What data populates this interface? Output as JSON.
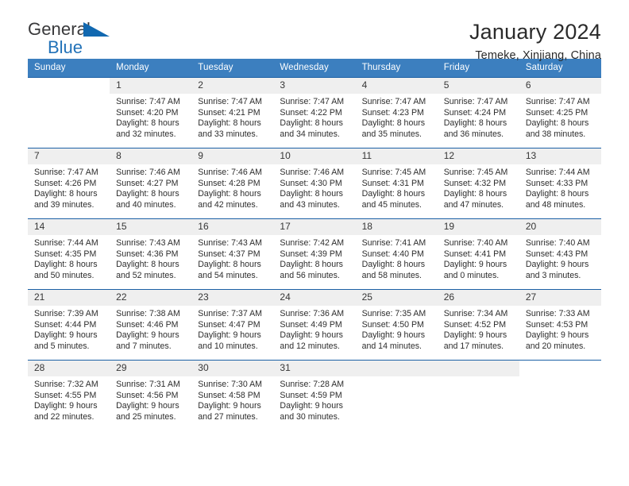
{
  "brand": {
    "name_top": "General",
    "name_bottom": "Blue",
    "accent_color": "#1168b0",
    "text_color": "#39393b"
  },
  "header": {
    "title": "January 2024",
    "subtitle": "Temeke, Xinjiang, China"
  },
  "theme": {
    "header_band": "#3c7fbf",
    "row_rule": "#1b60a5",
    "daynum_band": "#efefef"
  },
  "weekday_headers": [
    "Sunday",
    "Monday",
    "Tuesday",
    "Wednesday",
    "Thursday",
    "Friday",
    "Saturday"
  ],
  "labels": {
    "sunrise_prefix": "Sunrise:",
    "sunset_prefix": "Sunset:",
    "daylight_prefix": "Daylight:"
  },
  "weeks": [
    [
      {
        "day": "",
        "l1": "",
        "l2": "",
        "l3": "",
        "l4": "",
        "blank": true
      },
      {
        "day": "1",
        "l1": "Sunrise: 7:47 AM",
        "l2": "Sunset: 4:20 PM",
        "l3": "Daylight: 8 hours",
        "l4": "and 32 minutes."
      },
      {
        "day": "2",
        "l1": "Sunrise: 7:47 AM",
        "l2": "Sunset: 4:21 PM",
        "l3": "Daylight: 8 hours",
        "l4": "and 33 minutes."
      },
      {
        "day": "3",
        "l1": "Sunrise: 7:47 AM",
        "l2": "Sunset: 4:22 PM",
        "l3": "Daylight: 8 hours",
        "l4": "and 34 minutes."
      },
      {
        "day": "4",
        "l1": "Sunrise: 7:47 AM",
        "l2": "Sunset: 4:23 PM",
        "l3": "Daylight: 8 hours",
        "l4": "and 35 minutes."
      },
      {
        "day": "5",
        "l1": "Sunrise: 7:47 AM",
        "l2": "Sunset: 4:24 PM",
        "l3": "Daylight: 8 hours",
        "l4": "and 36 minutes."
      },
      {
        "day": "6",
        "l1": "Sunrise: 7:47 AM",
        "l2": "Sunset: 4:25 PM",
        "l3": "Daylight: 8 hours",
        "l4": "and 38 minutes."
      }
    ],
    [
      {
        "day": "7",
        "l1": "Sunrise: 7:47 AM",
        "l2": "Sunset: 4:26 PM",
        "l3": "Daylight: 8 hours",
        "l4": "and 39 minutes."
      },
      {
        "day": "8",
        "l1": "Sunrise: 7:46 AM",
        "l2": "Sunset: 4:27 PM",
        "l3": "Daylight: 8 hours",
        "l4": "and 40 minutes."
      },
      {
        "day": "9",
        "l1": "Sunrise: 7:46 AM",
        "l2": "Sunset: 4:28 PM",
        "l3": "Daylight: 8 hours",
        "l4": "and 42 minutes."
      },
      {
        "day": "10",
        "l1": "Sunrise: 7:46 AM",
        "l2": "Sunset: 4:30 PM",
        "l3": "Daylight: 8 hours",
        "l4": "and 43 minutes."
      },
      {
        "day": "11",
        "l1": "Sunrise: 7:45 AM",
        "l2": "Sunset: 4:31 PM",
        "l3": "Daylight: 8 hours",
        "l4": "and 45 minutes."
      },
      {
        "day": "12",
        "l1": "Sunrise: 7:45 AM",
        "l2": "Sunset: 4:32 PM",
        "l3": "Daylight: 8 hours",
        "l4": "and 47 minutes."
      },
      {
        "day": "13",
        "l1": "Sunrise: 7:44 AM",
        "l2": "Sunset: 4:33 PM",
        "l3": "Daylight: 8 hours",
        "l4": "and 48 minutes."
      }
    ],
    [
      {
        "day": "14",
        "l1": "Sunrise: 7:44 AM",
        "l2": "Sunset: 4:35 PM",
        "l3": "Daylight: 8 hours",
        "l4": "and 50 minutes."
      },
      {
        "day": "15",
        "l1": "Sunrise: 7:43 AM",
        "l2": "Sunset: 4:36 PM",
        "l3": "Daylight: 8 hours",
        "l4": "and 52 minutes."
      },
      {
        "day": "16",
        "l1": "Sunrise: 7:43 AM",
        "l2": "Sunset: 4:37 PM",
        "l3": "Daylight: 8 hours",
        "l4": "and 54 minutes."
      },
      {
        "day": "17",
        "l1": "Sunrise: 7:42 AM",
        "l2": "Sunset: 4:39 PM",
        "l3": "Daylight: 8 hours",
        "l4": "and 56 minutes."
      },
      {
        "day": "18",
        "l1": "Sunrise: 7:41 AM",
        "l2": "Sunset: 4:40 PM",
        "l3": "Daylight: 8 hours",
        "l4": "and 58 minutes."
      },
      {
        "day": "19",
        "l1": "Sunrise: 7:40 AM",
        "l2": "Sunset: 4:41 PM",
        "l3": "Daylight: 9 hours",
        "l4": "and 0 minutes."
      },
      {
        "day": "20",
        "l1": "Sunrise: 7:40 AM",
        "l2": "Sunset: 4:43 PM",
        "l3": "Daylight: 9 hours",
        "l4": "and 3 minutes."
      }
    ],
    [
      {
        "day": "21",
        "l1": "Sunrise: 7:39 AM",
        "l2": "Sunset: 4:44 PM",
        "l3": "Daylight: 9 hours",
        "l4": "and 5 minutes."
      },
      {
        "day": "22",
        "l1": "Sunrise: 7:38 AM",
        "l2": "Sunset: 4:46 PM",
        "l3": "Daylight: 9 hours",
        "l4": "and 7 minutes."
      },
      {
        "day": "23",
        "l1": "Sunrise: 7:37 AM",
        "l2": "Sunset: 4:47 PM",
        "l3": "Daylight: 9 hours",
        "l4": "and 10 minutes."
      },
      {
        "day": "24",
        "l1": "Sunrise: 7:36 AM",
        "l2": "Sunset: 4:49 PM",
        "l3": "Daylight: 9 hours",
        "l4": "and 12 minutes."
      },
      {
        "day": "25",
        "l1": "Sunrise: 7:35 AM",
        "l2": "Sunset: 4:50 PM",
        "l3": "Daylight: 9 hours",
        "l4": "and 14 minutes."
      },
      {
        "day": "26",
        "l1": "Sunrise: 7:34 AM",
        "l2": "Sunset: 4:52 PM",
        "l3": "Daylight: 9 hours",
        "l4": "and 17 minutes."
      },
      {
        "day": "27",
        "l1": "Sunrise: 7:33 AM",
        "l2": "Sunset: 4:53 PM",
        "l3": "Daylight: 9 hours",
        "l4": "and 20 minutes."
      }
    ],
    [
      {
        "day": "28",
        "l1": "Sunrise: 7:32 AM",
        "l2": "Sunset: 4:55 PM",
        "l3": "Daylight: 9 hours",
        "l4": "and 22 minutes."
      },
      {
        "day": "29",
        "l1": "Sunrise: 7:31 AM",
        "l2": "Sunset: 4:56 PM",
        "l3": "Daylight: 9 hours",
        "l4": "and 25 minutes."
      },
      {
        "day": "30",
        "l1": "Sunrise: 7:30 AM",
        "l2": "Sunset: 4:58 PM",
        "l3": "Daylight: 9 hours",
        "l4": "and 27 minutes."
      },
      {
        "day": "31",
        "l1": "Sunrise: 7:28 AM",
        "l2": "Sunset: 4:59 PM",
        "l3": "Daylight: 9 hours",
        "l4": "and 30 minutes."
      },
      {
        "day": "",
        "l1": "",
        "l2": "",
        "l3": "",
        "l4": "",
        "empty": true
      },
      {
        "day": "",
        "l1": "",
        "l2": "",
        "l3": "",
        "l4": "",
        "empty": true
      },
      {
        "day": "",
        "l1": "",
        "l2": "",
        "l3": "",
        "l4": "",
        "blank": true
      }
    ]
  ]
}
